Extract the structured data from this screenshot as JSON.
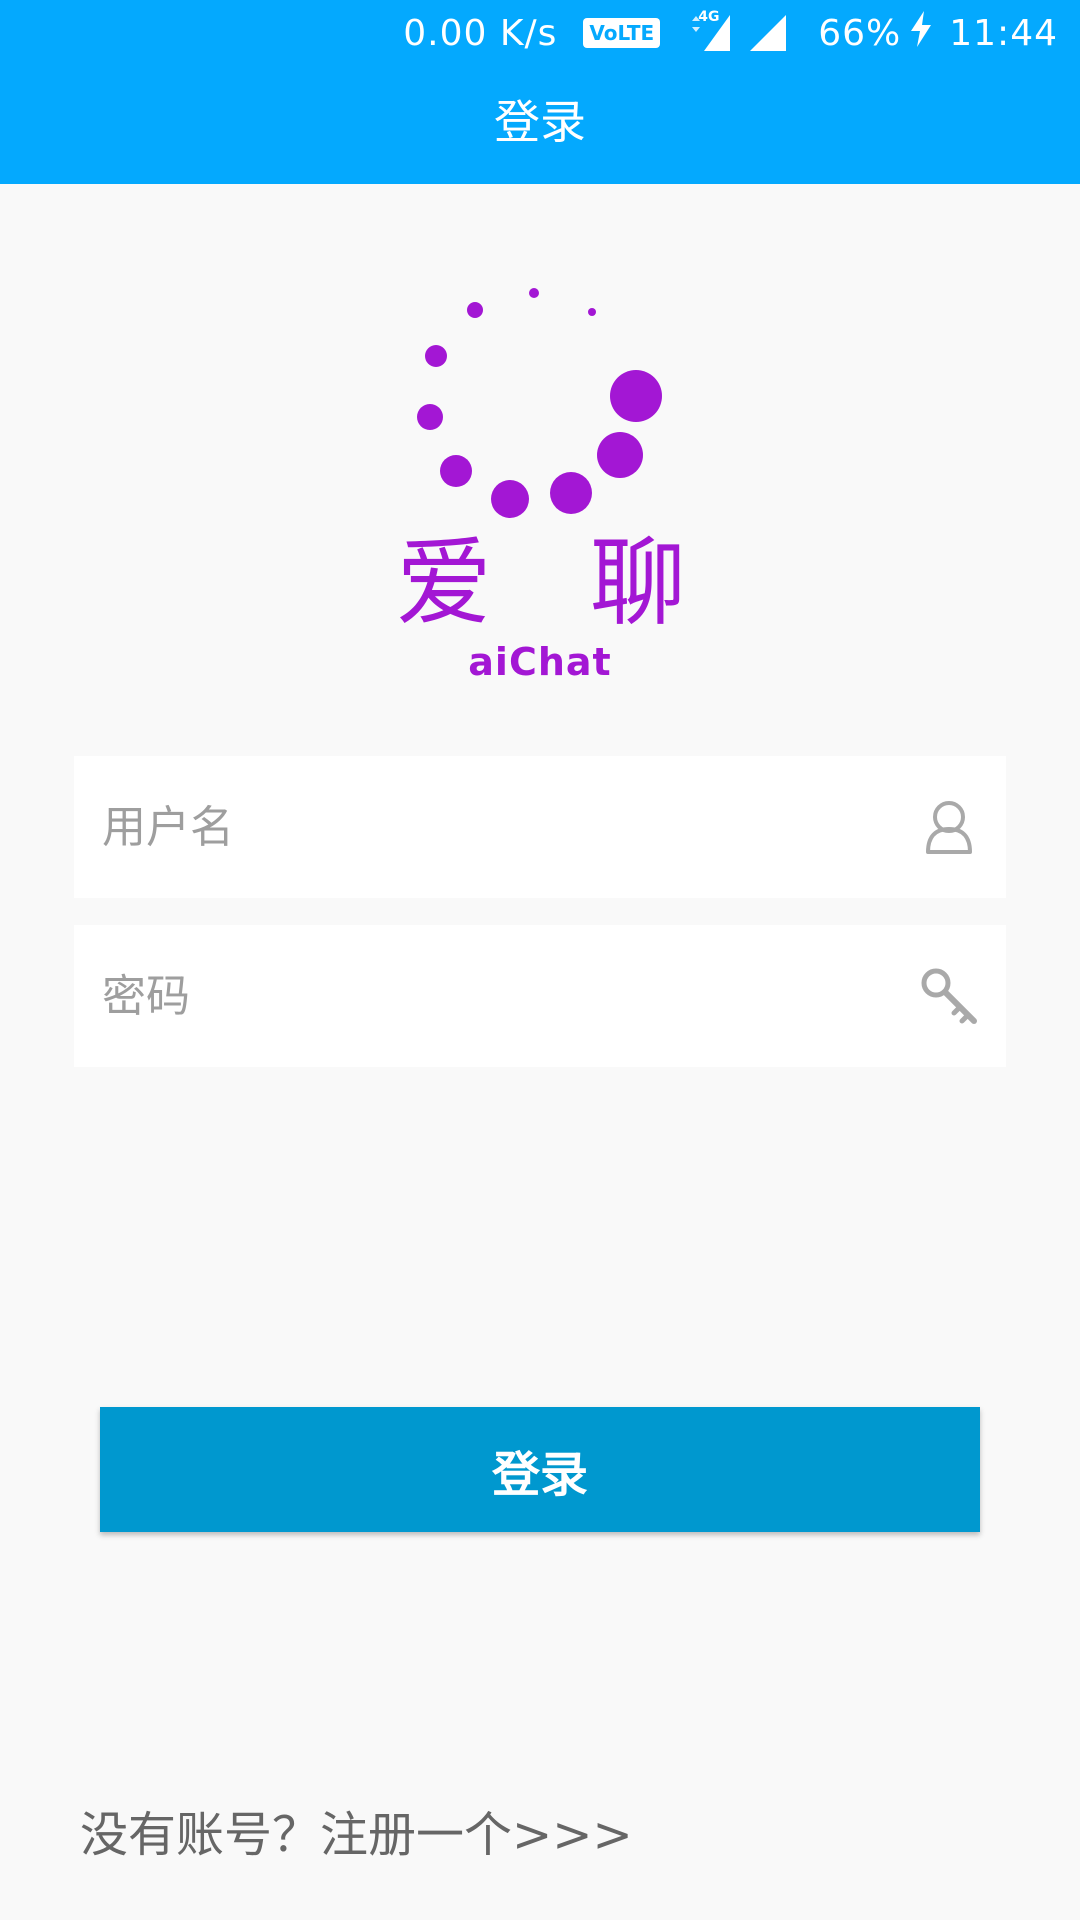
{
  "status_bar": {
    "net_speed": "0.00 K/s",
    "volte": "VoLTE",
    "network_type": "4G",
    "battery": "66%",
    "time": "11:44"
  },
  "app_bar": {
    "title": "登录"
  },
  "logo": {
    "name_chars": [
      "爱",
      "聊"
    ],
    "name_en": "aiChat",
    "color": "#a317d4"
  },
  "form": {
    "username_placeholder": "用户名",
    "username_value": "",
    "password_placeholder": "密码",
    "password_value": "",
    "login_label": "登录"
  },
  "register_link": "没有账号？注册一个>>>",
  "colors": {
    "primary": "#04a9fe",
    "button": "#0098cf",
    "background": "#f9f9f9"
  },
  "icons": {
    "username": "user-icon",
    "password": "key-icon",
    "charging": "charging-bolt-icon"
  }
}
